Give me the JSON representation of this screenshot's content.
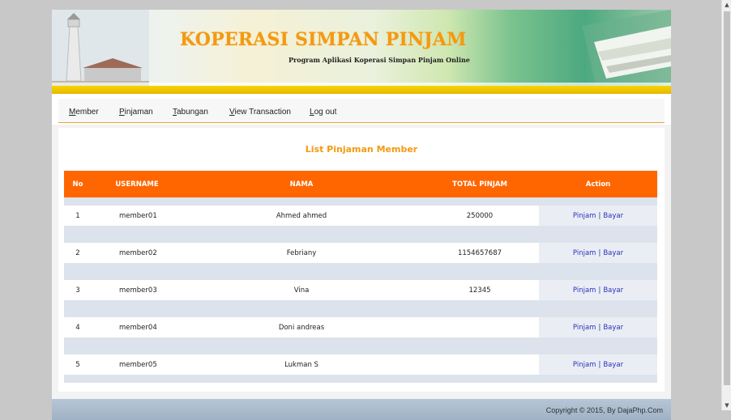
{
  "header": {
    "title": "KOPERASI SIMPAN PINJAM",
    "subtitle": "Program Aplikasi Koperasi Simpan Pinjam Online"
  },
  "nav": [
    {
      "first": "M",
      "rest": "ember"
    },
    {
      "first": "P",
      "rest": "injaman"
    },
    {
      "first": "T",
      "rest": "abungan"
    },
    {
      "first": "V",
      "rest": "iew Transaction"
    },
    {
      "first": "L",
      "rest": "og out"
    }
  ],
  "main": {
    "title": "List Pinjaman Member",
    "columns": [
      "No",
      "USERNAME",
      "NAMA",
      "TOTAL PINJAM",
      "Action"
    ],
    "rows": [
      {
        "no": "1",
        "username": "member01",
        "nama": "Ahmed ahmed",
        "total": "250000"
      },
      {
        "no": "2",
        "username": "member02",
        "nama": "Febriany",
        "total": "1154657687"
      },
      {
        "no": "3",
        "username": "member03",
        "nama": "Vina",
        "total": "12345"
      },
      {
        "no": "4",
        "username": "member04",
        "nama": "Doni andreas",
        "total": ""
      },
      {
        "no": "5",
        "username": "member05",
        "nama": "Lukman S",
        "total": ""
      }
    ],
    "actions": {
      "pinjam": "Pinjam",
      "separator": "|",
      "bayar": "Bayar"
    }
  },
  "footer": {
    "copyright": "Copyright © 2015, By DajaPhp.Com"
  },
  "colors": {
    "accent": "#ff6600",
    "title": "#f39a12",
    "link": "#2a2fb8"
  }
}
